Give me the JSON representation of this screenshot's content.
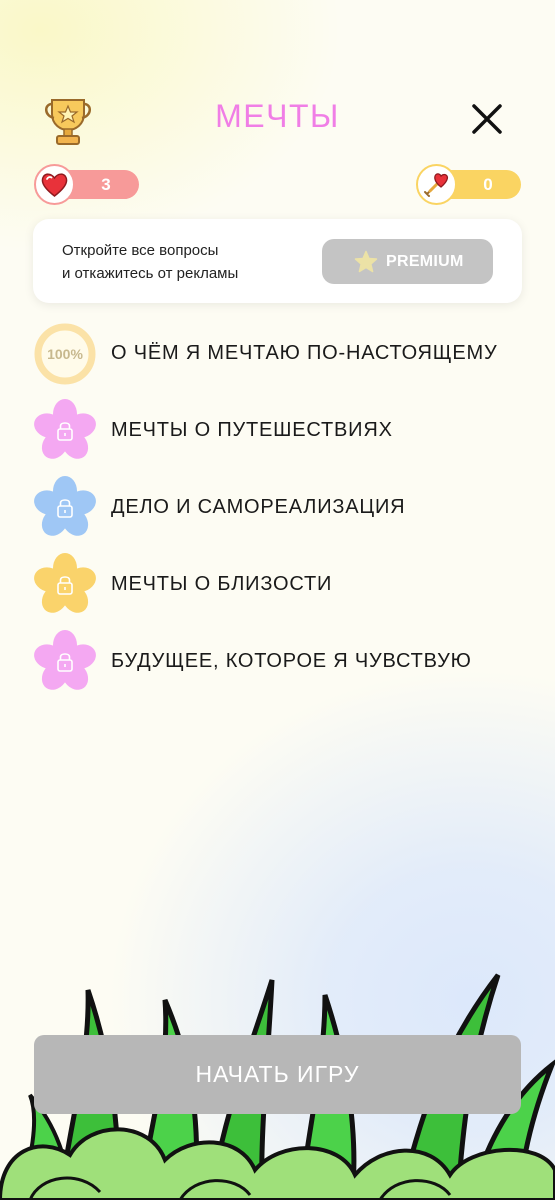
{
  "header": {
    "title": "МЕЧТЫ",
    "trophy_icon": "trophy-icon",
    "close_icon": "close-icon"
  },
  "counters": {
    "hearts": {
      "icon": "heart-icon",
      "value": "3",
      "color": "#f79a99"
    },
    "keys": {
      "icon": "key-icon",
      "value": "0",
      "color": "#fad462"
    }
  },
  "promo": {
    "line1": "Откройте все вопросы",
    "line2": "и откажитесь от рекламы",
    "button_label": "PREMIUM",
    "button_icon": "star-icon"
  },
  "topics": [
    {
      "name": "О ЧЁМ Я МЕЧТАЮ ПО-НАСТОЯЩЕМУ",
      "progress": "100%",
      "locked": false,
      "icon": "progress-ring-icon"
    },
    {
      "name": "МЕЧТЫ О ПУТЕШЕСТВИЯХ",
      "locked": true,
      "color": "#f4a8f2",
      "icon": "lock-icon"
    },
    {
      "name": "ДЕЛО И САМОРЕАЛИЗАЦИЯ",
      "locked": true,
      "color": "#9fc7f5",
      "icon": "lock-icon"
    },
    {
      "name": "МЕЧТЫ О БЛИЗОСТИ",
      "locked": true,
      "color": "#fad36b",
      "icon": "lock-icon"
    },
    {
      "name": "БУДУЩЕЕ, КОТОРОЕ Я ЧУВСТВУЮ",
      "locked": true,
      "color": "#f4a8f2",
      "icon": "lock-icon"
    }
  ],
  "start_button": {
    "label": "НАЧАТЬ ИГРУ"
  },
  "colors": {
    "title": "#f07ee6",
    "background": "#fdfcf3",
    "button_disabled": "#b7b7b7",
    "premium_button": "#c4c4c4"
  }
}
